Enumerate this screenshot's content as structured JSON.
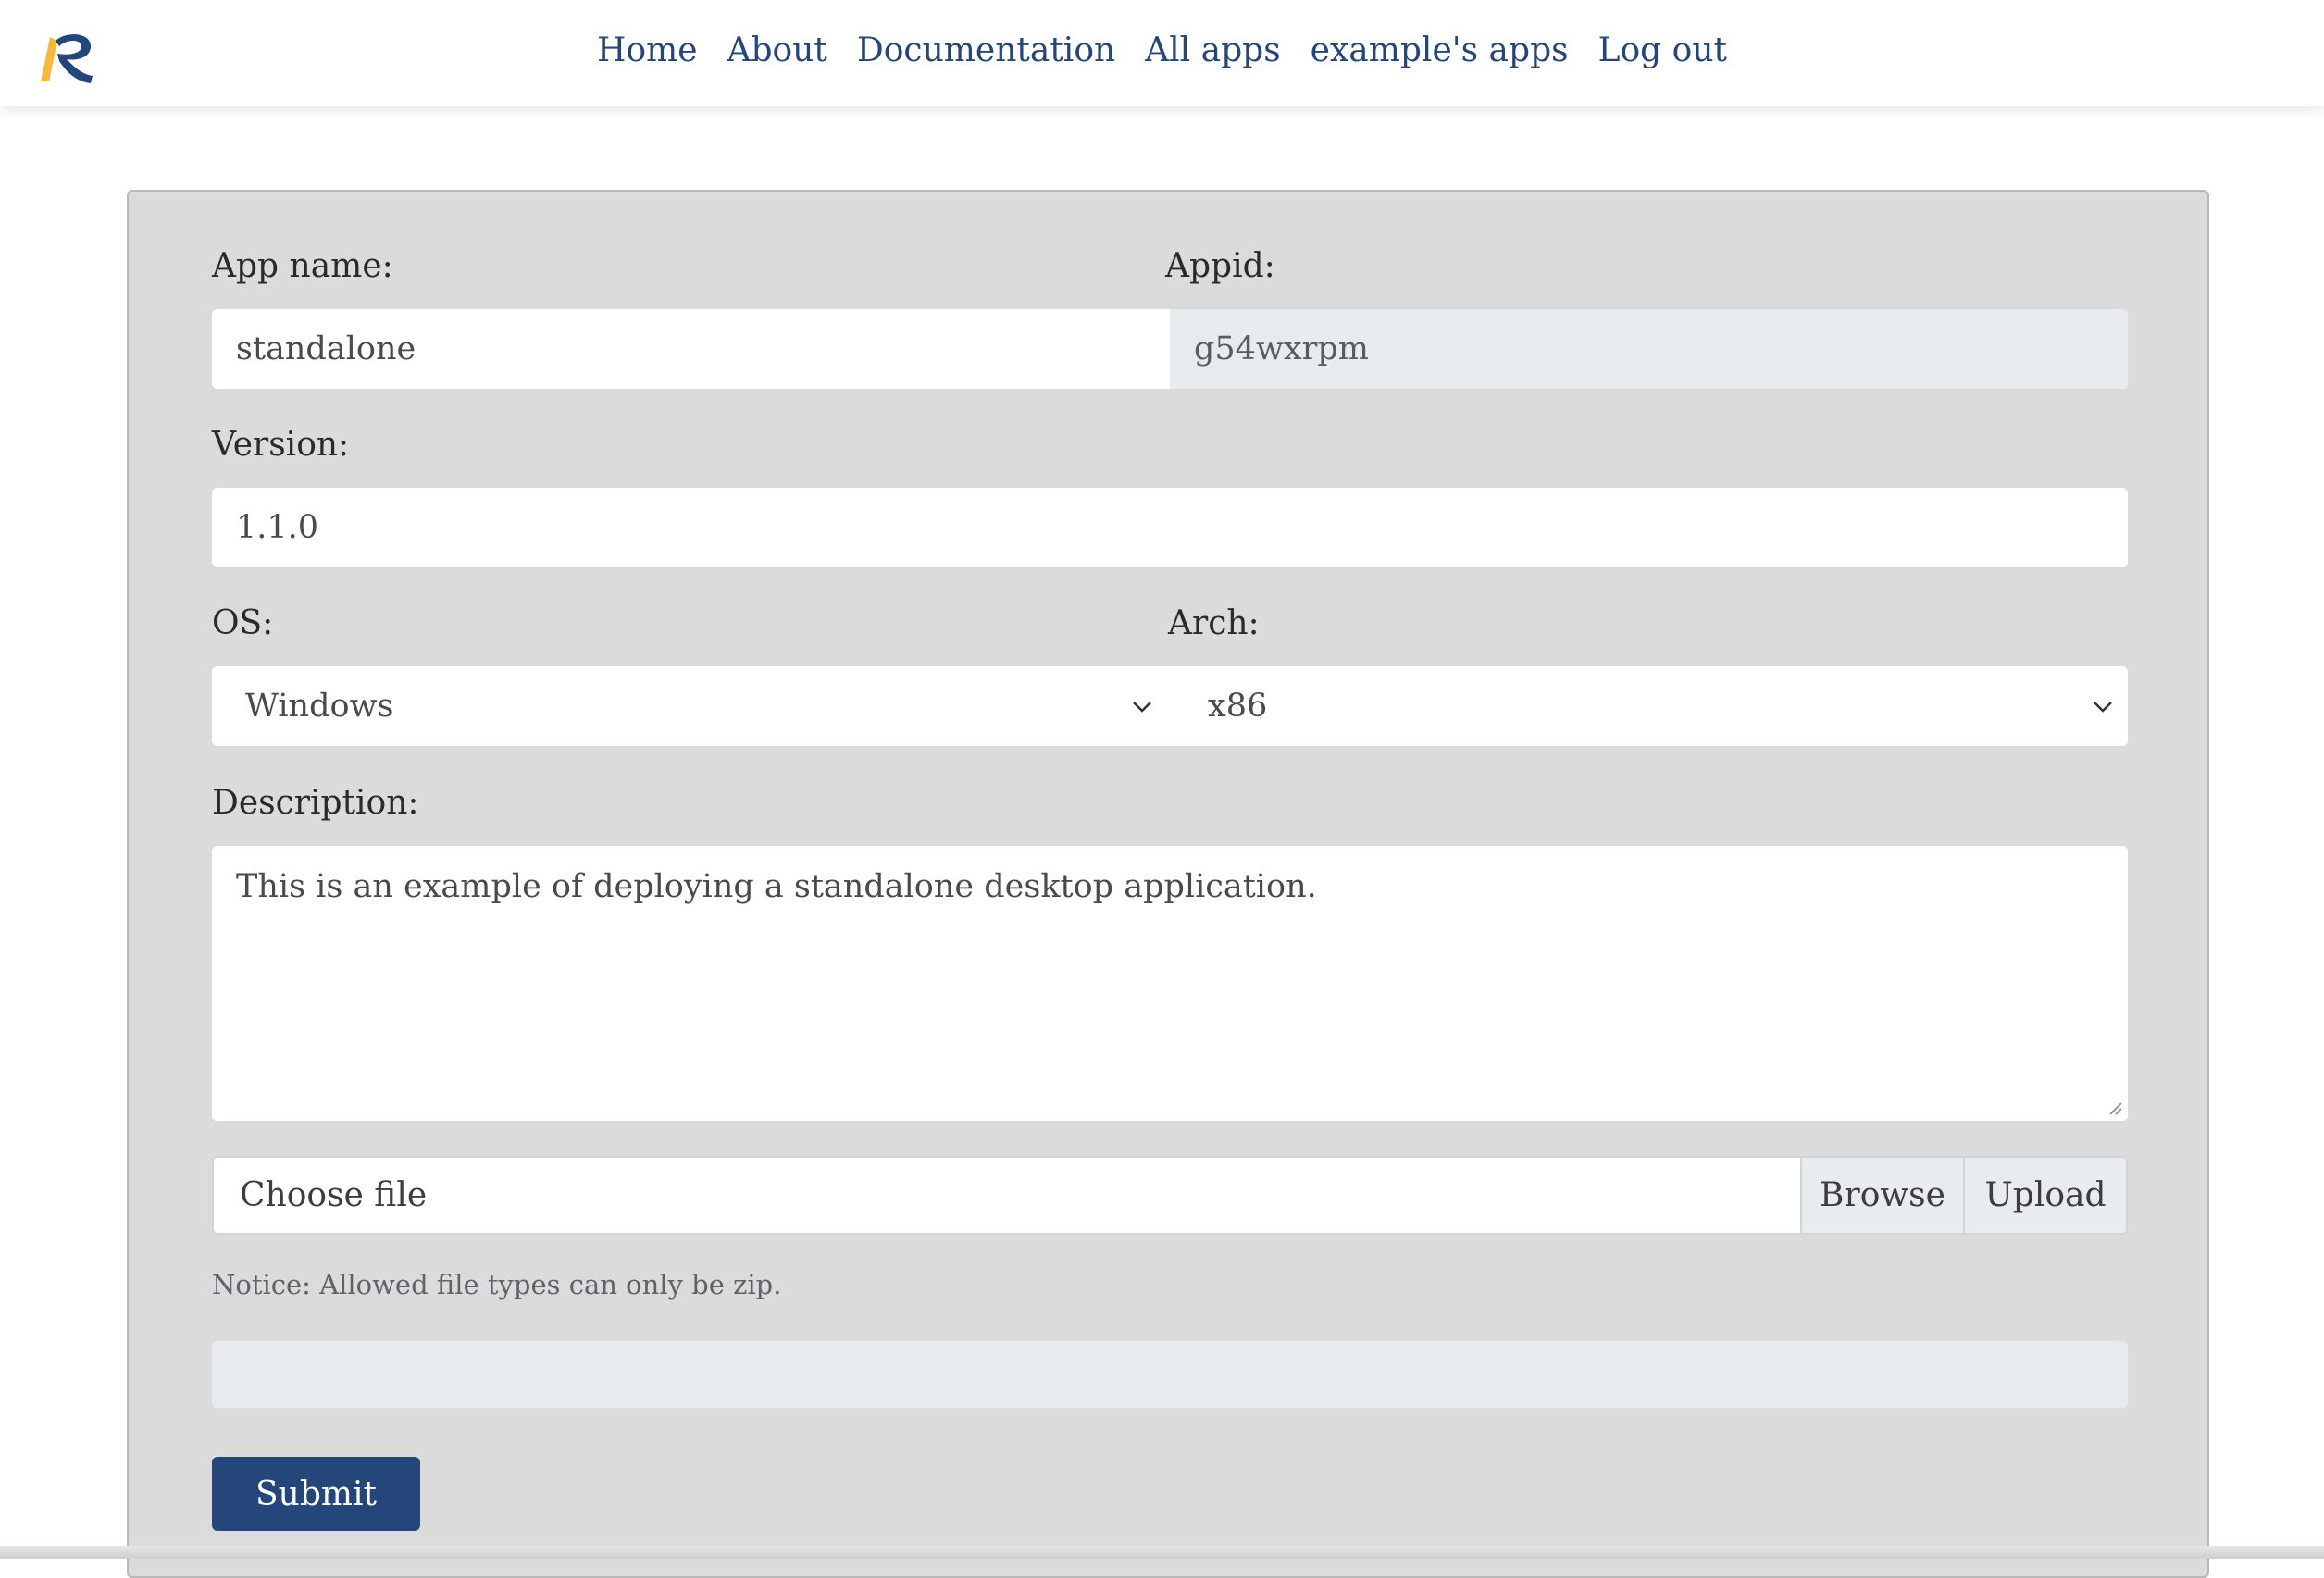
{
  "nav": {
    "links": [
      "Home",
      "About",
      "Documentation",
      "All apps",
      "example's apps",
      "Log out"
    ]
  },
  "form": {
    "app_name_label": "App name:",
    "app_name_value": "standalone",
    "appid_label": "Appid:",
    "appid_value": "g54wxrpm",
    "version_label": "Version:",
    "version_value": "1.1.0",
    "os_label": "OS:",
    "os_value": "Windows",
    "arch_label": "Arch:",
    "arch_value": "x86",
    "description_label": "Description:",
    "description_value": "This is an example of deploying a standalone desktop application.",
    "file_label": "Choose file",
    "browse_label": "Browse",
    "upload_label": "Upload",
    "notice": "Notice: Allowed file types can only be zip.",
    "upload_progress": 0,
    "submit_label": "Submit"
  },
  "colors": {
    "brand_blue": "#25467a",
    "logo_yellow": "#f6b93b",
    "panel_bg": "#dbdbdb"
  }
}
